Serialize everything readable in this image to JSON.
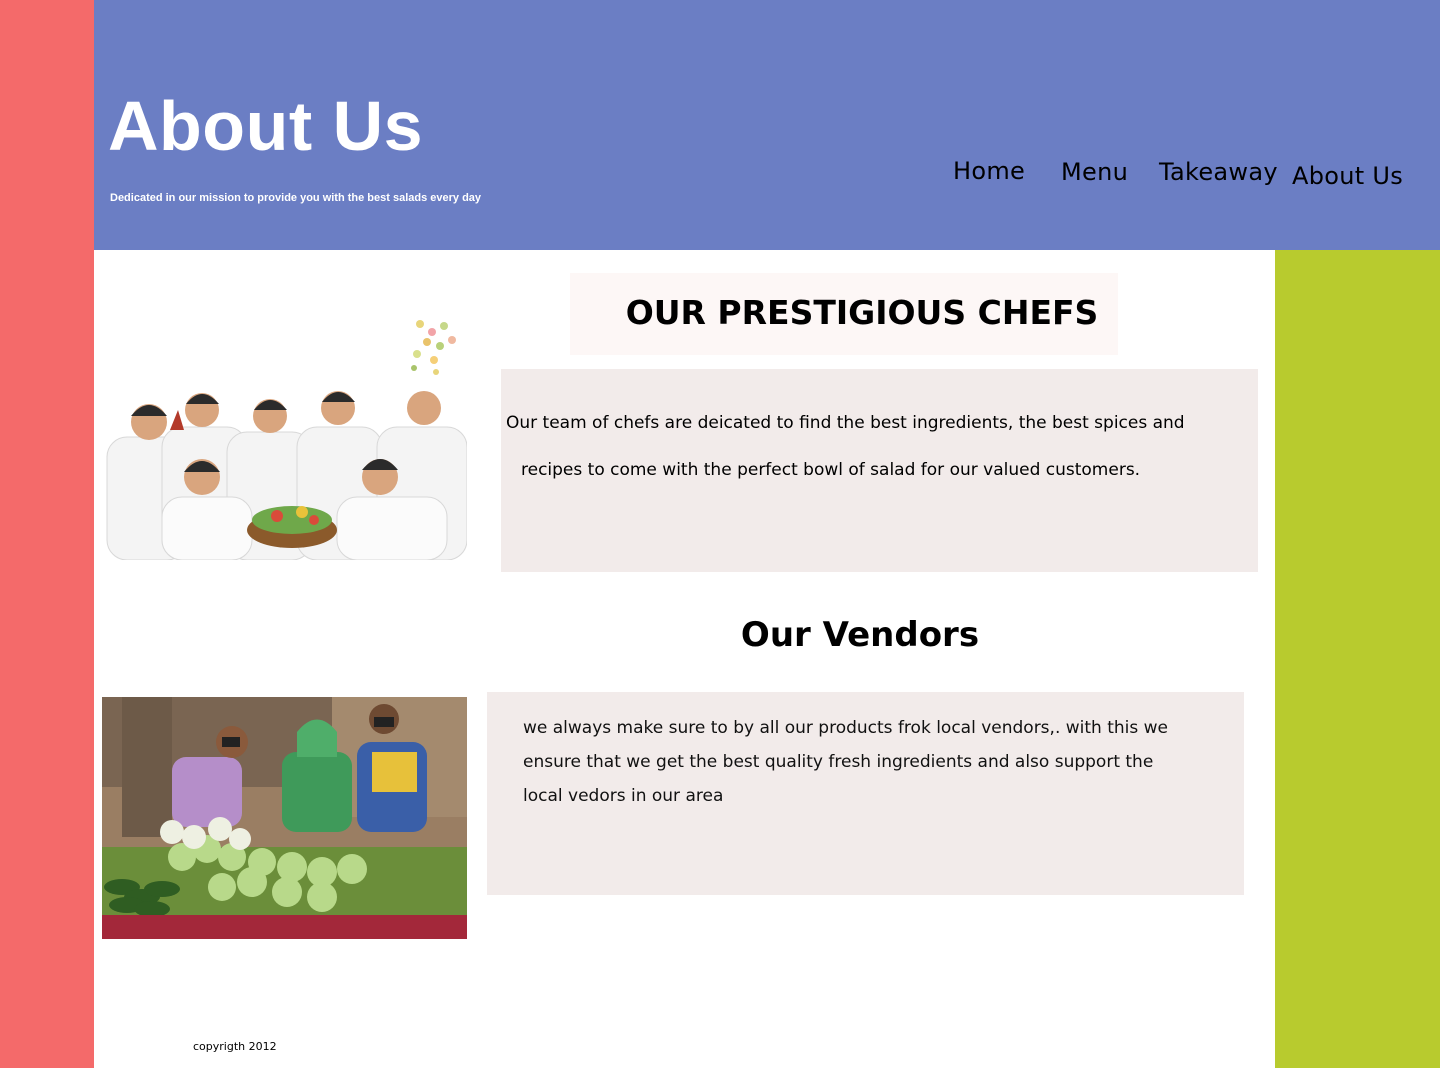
{
  "header": {
    "title": "About Us",
    "subtitle": "Dedicated in our mission to provide you with the best salads every day"
  },
  "nav": {
    "items": [
      {
        "label": "Home"
      },
      {
        "label": "Menu"
      },
      {
        "label": "Takeaway"
      },
      {
        "label": "About Us"
      }
    ]
  },
  "chefs": {
    "title": "OUR PRESTIGIOUS CHEFS",
    "line1": "Our team of chefs are deicated to find the best ingredients, the best spices and",
    "line2": "recipes to come with the perfect bowl of salad for our valued customers."
  },
  "vendors": {
    "title": "Our Vendors",
    "line1": "we always make sure to by all our products frok local vendors,. with this  we",
    "line2": "ensure that we get  the best quality fresh ingredients and also support the",
    "line3": "local vedors in our area"
  },
  "footer": {
    "copyright": "copyrigth 2012"
  },
  "colors": {
    "left_bar": "#f46a6a",
    "header": "#6b7ec4",
    "right_bar": "#b8cb2e",
    "text_box": "#f2ebea"
  }
}
